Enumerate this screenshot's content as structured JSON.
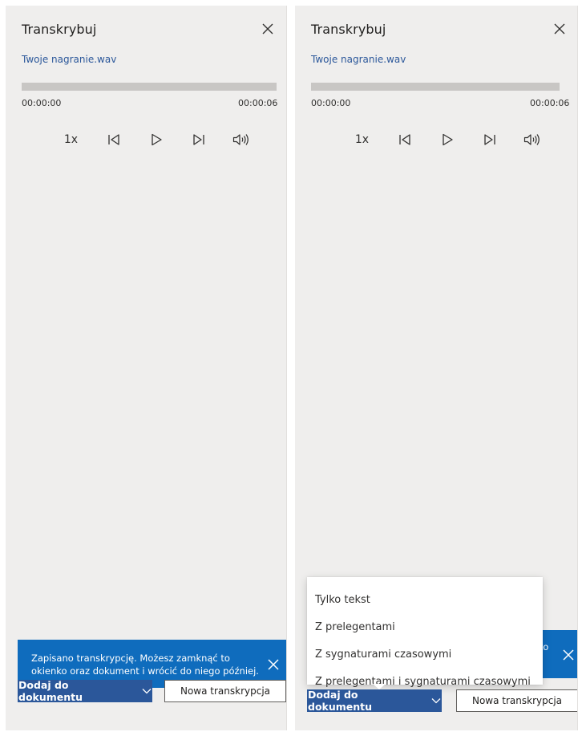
{
  "panel_left": {
    "title": "Transkrybuj",
    "file_name": "Twoje nagranie.wav",
    "time_start": "00:00:00",
    "time_end": "00:00:06",
    "speed": "1x",
    "toast_message": "Zapisano transkrypcję. Możesz zamknąć to okienko oraz dokument i wrócić do niego później.",
    "add_button": "Dodaj do dokumentu",
    "new_button": "Nowa transkrypcja"
  },
  "panel_right": {
    "title": "Transkrybuj",
    "file_name": "Twoje nagranie.wav",
    "time_start": "00:00:00",
    "time_end": "00:00:06",
    "speed": "1x",
    "toast_fragment": "ko",
    "add_button": "Dodaj do dokumentu",
    "new_button": "Nowa transkrypcja",
    "dropdown": [
      "Tylko tekst",
      "Z prelegentami",
      "Z sygnaturami czasowymi",
      "Z prelegentami i sygnaturami czasowymi"
    ]
  },
  "colors": {
    "panel_bg": "#efeeed",
    "accent": "#2b579a",
    "toast": "#0f6cbd",
    "progress_track": "#c8c6c4"
  },
  "icons": [
    "close-icon",
    "previous-icon",
    "play-icon",
    "next-icon",
    "volume-icon",
    "chevron-down-icon"
  ]
}
